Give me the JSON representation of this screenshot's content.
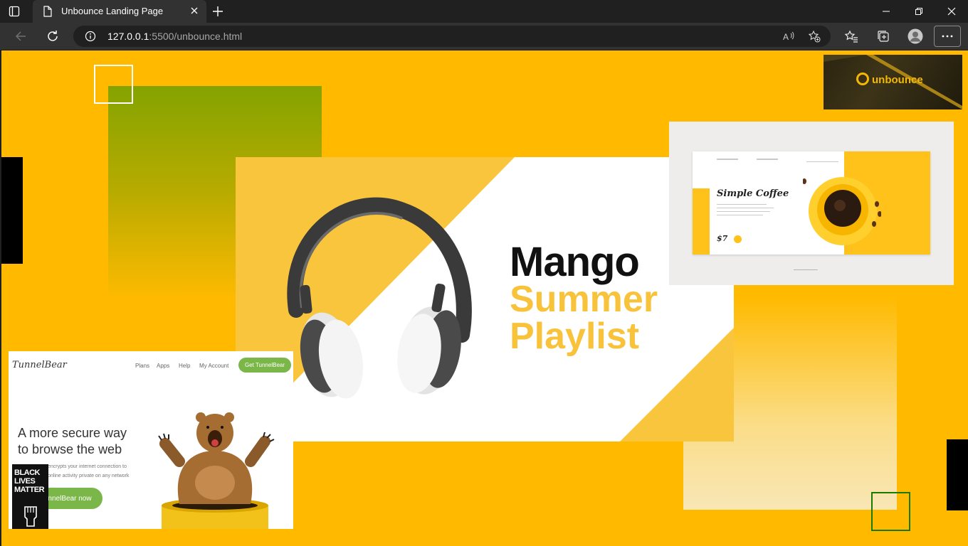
{
  "browser": {
    "tab_title": "Unbounce Landing Page",
    "url_host": "127.0.0.1",
    "url_path": ":5500/unbounce.html"
  },
  "page": {
    "background_color": "#ffba00",
    "unbounce_logo": {
      "text": "unbounce"
    },
    "mango_banner": {
      "title": "Mango",
      "subtitle_line1": "Summer",
      "subtitle_line2": "Playlist"
    },
    "coffee_card": {
      "title": "Simple Coffee",
      "price": "$7"
    },
    "tunnelbear_card": {
      "logo": "TunnelBear",
      "nav": [
        "Plans",
        "Apps",
        "Help",
        "My Account"
      ],
      "cta": "Get TunnelBear",
      "headline_line1": "A more secure way",
      "headline_line2": "to browse the web",
      "copy_line1": "encrypts your internet connection to",
      "copy_line2": "online activity private on any network",
      "button": "nnelBear now",
      "blm_text": [
        "BLACK",
        "LIVES",
        "MATTER"
      ]
    }
  }
}
